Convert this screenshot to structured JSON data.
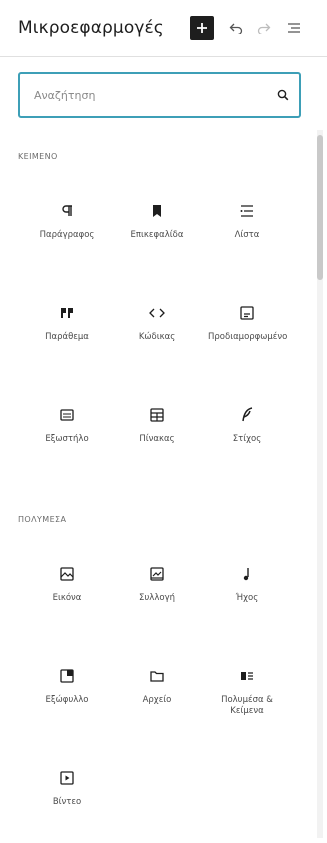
{
  "header": {
    "title": "Μικροεφαρμογές",
    "icons": [
      "plus-icon",
      "undo-icon",
      "redo-icon",
      "list-view-icon"
    ]
  },
  "search": {
    "placeholder": "Αναζήτηση",
    "value": ""
  },
  "categories": [
    {
      "label": "ΚΕΙΜΕΝΟ",
      "blocks": [
        {
          "label": "Παράγραφος",
          "icon": "paragraph-icon"
        },
        {
          "label": "Επικεφαλίδα",
          "icon": "heading-icon"
        },
        {
          "label": "Λίστα",
          "icon": "list-icon"
        },
        {
          "label": "Παράθεμα",
          "icon": "quote-icon"
        },
        {
          "label": "Κώδικας",
          "icon": "code-icon"
        },
        {
          "label": "Προδιαμορφωμένο",
          "icon": "preformatted-icon"
        },
        {
          "label": "Εξωστήλο",
          "icon": "pullquote-icon"
        },
        {
          "label": "Πίνακας",
          "icon": "table-icon"
        },
        {
          "label": "Στίχος",
          "icon": "verse-icon"
        }
      ]
    },
    {
      "label": "ΠΟΛΥΜΕΣΑ",
      "blocks": [
        {
          "label": "Εικόνα",
          "icon": "image-icon"
        },
        {
          "label": "Συλλογή",
          "icon": "gallery-icon"
        },
        {
          "label": "Ήχος",
          "icon": "audio-icon"
        },
        {
          "label": "Εξώφυλλο",
          "icon": "cover-icon"
        },
        {
          "label": "Αρχείο",
          "icon": "file-icon"
        },
        {
          "label": "Πολυμέσα & Κείμενα",
          "icon": "media-text-icon"
        },
        {
          "label": "Βίντεο",
          "icon": "video-icon"
        }
      ]
    }
  ],
  "colors": {
    "accent": "#3d9fb7",
    "text": "#1e1e1e",
    "muted": "#6b6b6b"
  }
}
